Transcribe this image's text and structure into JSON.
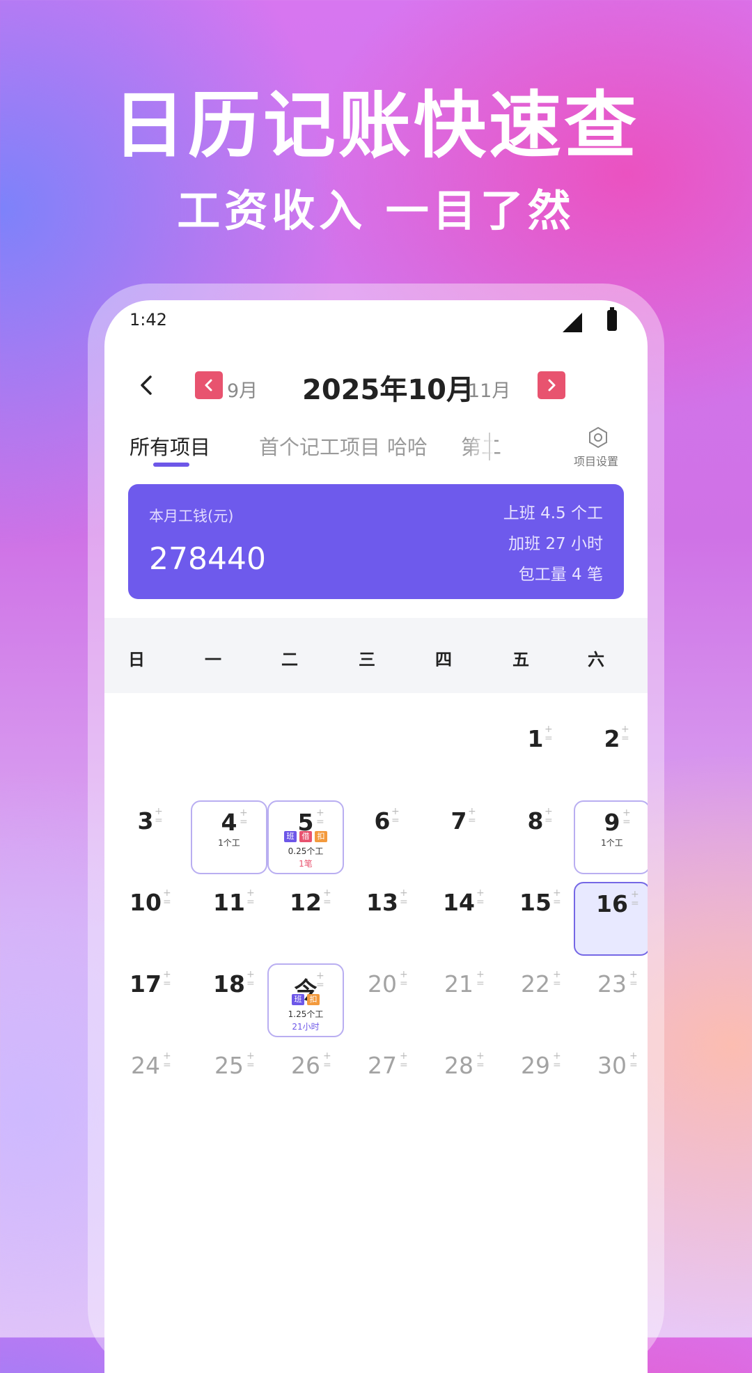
{
  "promo": {
    "headline": "日历记账快速查",
    "subline": "工资收入 一目了然"
  },
  "status_bar": {
    "time": "1:42"
  },
  "header": {
    "prev_month": "9月",
    "current_month": "2025年10月",
    "next_month": "11月"
  },
  "tabs": [
    {
      "label": "所有项目",
      "active": true
    },
    {
      "label": "首个记工项目",
      "active": false
    },
    {
      "label": "哈哈",
      "active": false
    },
    {
      "label": "第二",
      "active": false
    }
  ],
  "settings_label": "项目设置",
  "summary": {
    "label": "本月工钱(元)",
    "value": "278440",
    "stats": [
      "上班 4.5 个工",
      "加班 27 小时",
      "包工量 4 笔"
    ]
  },
  "weekdays": [
    "日",
    "一",
    "二",
    "三",
    "四",
    "五",
    "六"
  ],
  "calendar": {
    "days": [
      {
        "label": "1"
      },
      {
        "label": "2"
      },
      {
        "label": "3"
      },
      {
        "label": "4",
        "lines": [
          "1个工"
        ]
      },
      {
        "label": "5",
        "badges": [
          "班",
          "借",
          "扣"
        ],
        "lines": [
          "0.25个工",
          "1笔"
        ]
      },
      {
        "label": "6"
      },
      {
        "label": "7"
      },
      {
        "label": "8"
      },
      {
        "label": "9",
        "lines": [
          "1个工"
        ]
      },
      {
        "label": "10"
      },
      {
        "label": "11"
      },
      {
        "label": "12"
      },
      {
        "label": "13"
      },
      {
        "label": "14"
      },
      {
        "label": "15"
      },
      {
        "label": "16",
        "selected": true
      },
      {
        "label": "17"
      },
      {
        "label": "18"
      },
      {
        "label": "今",
        "badges": [
          "班",
          "扣"
        ],
        "lines": [
          "1.25个工",
          "21小时"
        ]
      },
      {
        "label": "20",
        "future": true
      },
      {
        "label": "21",
        "future": true
      },
      {
        "label": "22",
        "future": true
      },
      {
        "label": "23",
        "future": true
      },
      {
        "label": "24",
        "future": true
      },
      {
        "label": "25",
        "future": true
      },
      {
        "label": "26",
        "future": true
      },
      {
        "label": "27",
        "future": true
      },
      {
        "label": "28",
        "future": true
      },
      {
        "label": "29",
        "future": true
      },
      {
        "label": "30",
        "future": true
      }
    ],
    "badge_colors": {
      "班": "#6d57e8",
      "借": "#e8536f",
      "扣": "#f39a3d"
    }
  }
}
